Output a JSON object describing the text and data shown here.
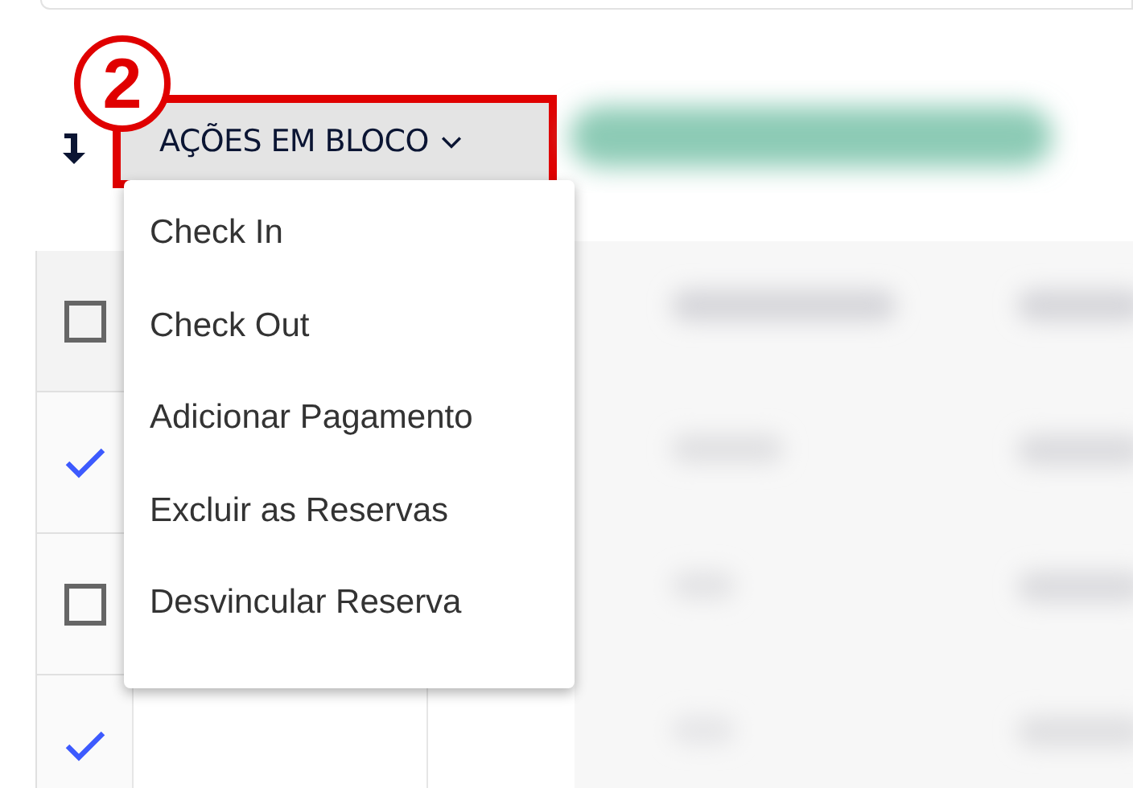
{
  "annotation": {
    "number": "2"
  },
  "toolbar": {
    "bulk_button": {
      "label": "AÇÕES EM BLOCO",
      "highlighted": true,
      "expanded": true
    }
  },
  "menu": {
    "items": [
      {
        "label": "Check In"
      },
      {
        "label": "Check Out"
      },
      {
        "label": "Adicionar Pagamento"
      },
      {
        "label": "Excluir as Reservas"
      },
      {
        "label": "Desvincular Reserva"
      }
    ]
  },
  "table": {
    "header_checked": false,
    "rows": [
      {
        "checked": true
      },
      {
        "checked": false
      },
      {
        "checked": true
      }
    ]
  }
}
